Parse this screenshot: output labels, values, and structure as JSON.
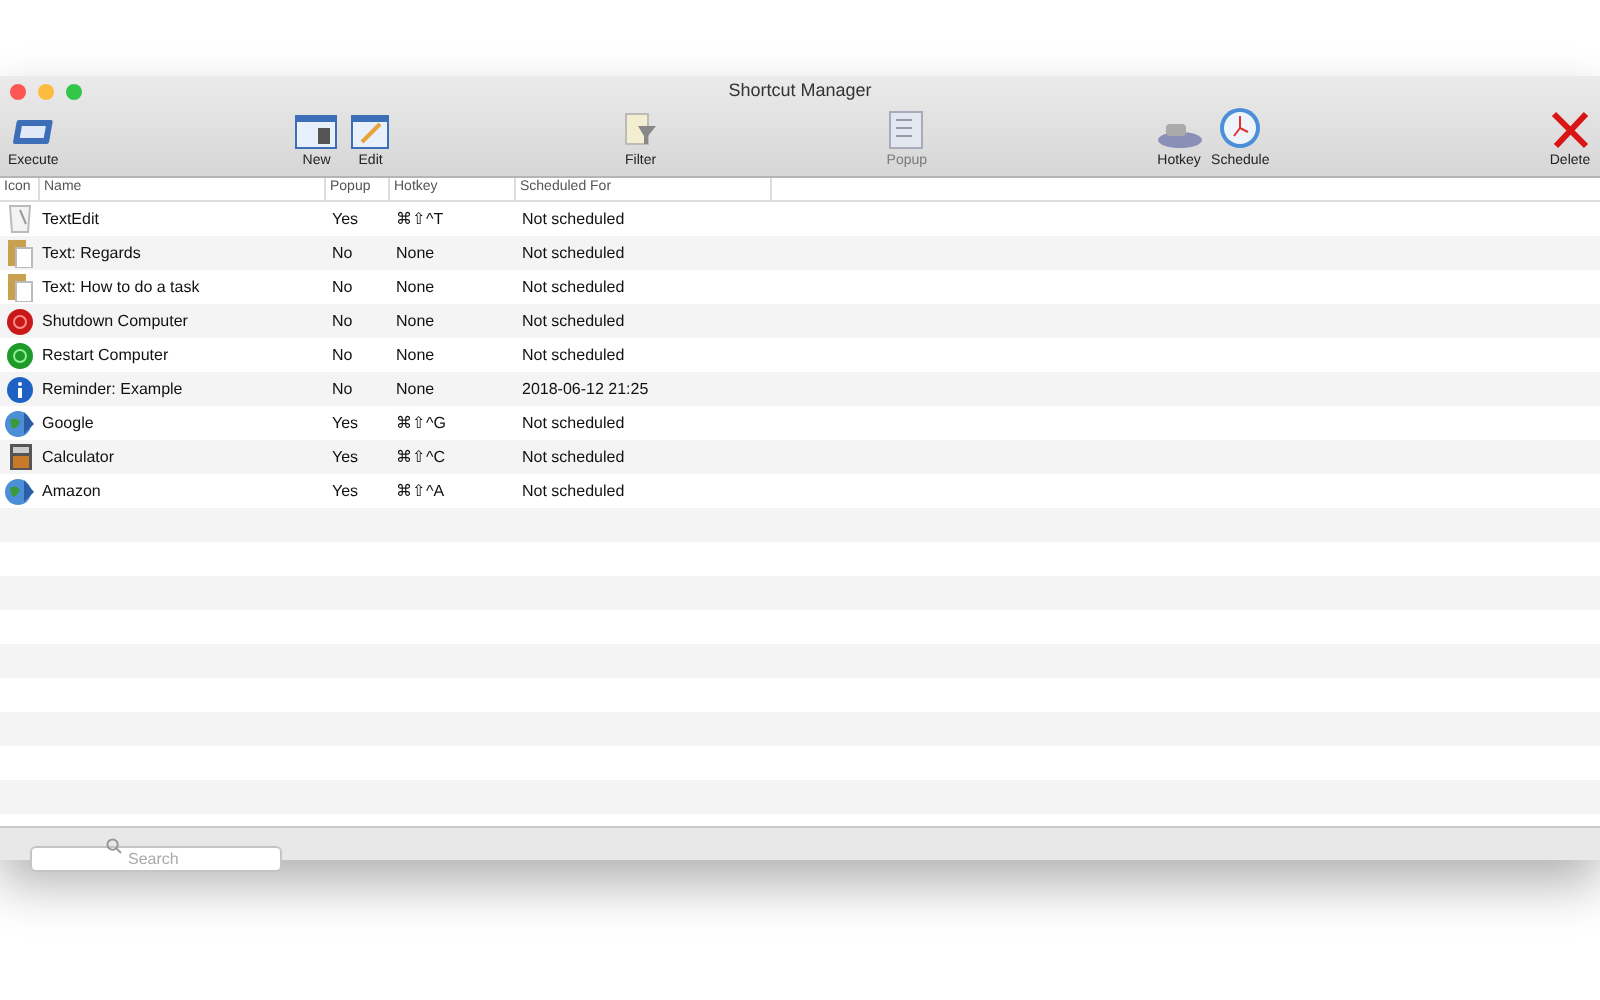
{
  "window": {
    "title": "Shortcut Manager"
  },
  "toolbar": [
    {
      "label": "Execute",
      "kind": "execute",
      "disabled": false
    },
    {
      "label": "New",
      "kind": "new",
      "disabled": false
    },
    {
      "label": "Edit",
      "kind": "edit",
      "disabled": false
    },
    {
      "label": "Filter",
      "kind": "filter",
      "disabled": false
    },
    {
      "label": "Popup",
      "kind": "popup",
      "disabled": true
    },
    {
      "label": "Hotkey",
      "kind": "hotkey",
      "disabled": false
    },
    {
      "label": "Schedule",
      "kind": "schedule",
      "disabled": false
    },
    {
      "label": "Delete",
      "kind": "delete",
      "disabled": false
    }
  ],
  "table": {
    "columns": [
      "Icon",
      "Name",
      "Popup",
      "Hotkey",
      "Scheduled For"
    ],
    "rows": [
      {
        "kind": "textedit",
        "name": "TextEdit",
        "popup": "Yes",
        "hotkey": "⌘⇧^T",
        "scheduled": "Not scheduled"
      },
      {
        "kind": "clipboard",
        "name": "Text: Regards",
        "popup": "No",
        "hotkey": "None",
        "scheduled": "Not scheduled"
      },
      {
        "kind": "clipboard",
        "name": "Text: How to do a task",
        "popup": "No",
        "hotkey": "None",
        "scheduled": "Not scheduled"
      },
      {
        "kind": "shutdown",
        "name": "Shutdown Computer",
        "popup": "No",
        "hotkey": "None",
        "scheduled": "Not scheduled"
      },
      {
        "kind": "restart",
        "name": "Restart Computer",
        "popup": "No",
        "hotkey": "None",
        "scheduled": "Not scheduled"
      },
      {
        "kind": "info",
        "name": "Reminder: Example",
        "popup": "No",
        "hotkey": "None",
        "scheduled": "2018-06-12 21:25"
      },
      {
        "kind": "globe",
        "name": "Google",
        "popup": "Yes",
        "hotkey": "⌘⇧^G",
        "scheduled": "Not scheduled"
      },
      {
        "kind": "calculator",
        "name": "Calculator",
        "popup": "Yes",
        "hotkey": "⌘⇧^C",
        "scheduled": "Not scheduled"
      },
      {
        "kind": "globe",
        "name": "Amazon",
        "popup": "Yes",
        "hotkey": "⌘⇧^A",
        "scheduled": "Not scheduled"
      }
    ]
  },
  "search": {
    "placeholder": "Search"
  }
}
